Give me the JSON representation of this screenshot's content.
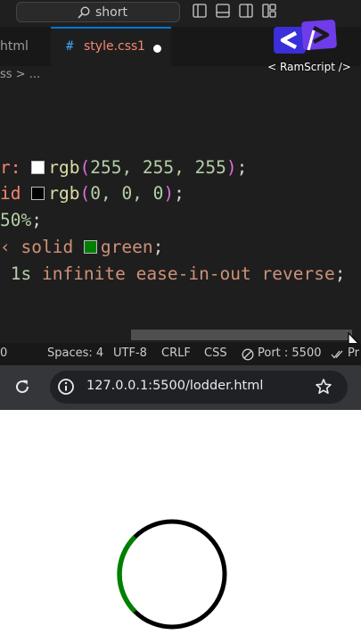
{
  "titlebar": {
    "search_text": "short",
    "layout_icons": [
      "toggle-sidebar-icon",
      "toggle-panel-icon",
      "toggle-secondary-sidebar-icon",
      "customize-layout-icon"
    ]
  },
  "tabs": [
    {
      "label": "html"
    },
    {
      "label": "style.css",
      "problems": "1",
      "modified": true,
      "icon": "#"
    }
  ],
  "breadcrumb": "ss > ...",
  "code_lines": [
    {
      "parts": [
        {
          "t": "r: ",
          "c": "c-prop"
        },
        {
          "swatch": "#ffffff"
        },
        {
          "t": "rgb",
          "c": "c-fn"
        },
        {
          "t": "(",
          "c": "c-paren"
        },
        {
          "t": "255, 255, 255",
          "c": "c-num"
        },
        {
          "t": ")",
          "c": "c-paren"
        },
        {
          "t": ";",
          "c": "c-punc"
        }
      ]
    },
    {
      "parts": [
        {
          "t": "id ",
          "c": "c-prop"
        },
        {
          "swatch": "#000000"
        },
        {
          "t": "rgb",
          "c": "c-fn"
        },
        {
          "t": "(",
          "c": "c-paren"
        },
        {
          "t": "0, 0, 0",
          "c": "c-num"
        },
        {
          "t": ")",
          "c": "c-paren"
        },
        {
          "t": ";",
          "c": "c-punc"
        }
      ]
    },
    {
      "parts": [
        {
          "t": "50%",
          "c": "c-num"
        },
        {
          "t": ";",
          "c": "c-punc"
        }
      ]
    },
    {
      "parts": [
        {
          "t": "‹ solid ",
          "c": "c-kw"
        },
        {
          "swatch": "#008000"
        },
        {
          "t": "green",
          "c": "c-val"
        },
        {
          "t": ";",
          "c": "c-punc"
        }
      ]
    },
    {
      "parts": [
        {
          "t": " 1s ",
          "c": "c-num"
        },
        {
          "t": "infinite ease-in-out reverse",
          "c": "c-kw"
        },
        {
          "t": ";",
          "c": "c-punc"
        }
      ]
    }
  ],
  "statusbar": {
    "left": "0",
    "spaces": "Spaces: 4",
    "encoding": "UTF-8",
    "eol": "CRLF",
    "language": "CSS",
    "port": "Port : 5500",
    "prettier": "Pr"
  },
  "browser": {
    "url": "127.0.0.1:5500/lodder.html"
  },
  "loader": {
    "ring_color": "#000000",
    "arc_color": "#008000"
  },
  "watermark": {
    "text": "< RamScript />",
    "colors": {
      "primary": "#3a2fd9",
      "accent": "#6e3ce8"
    }
  }
}
